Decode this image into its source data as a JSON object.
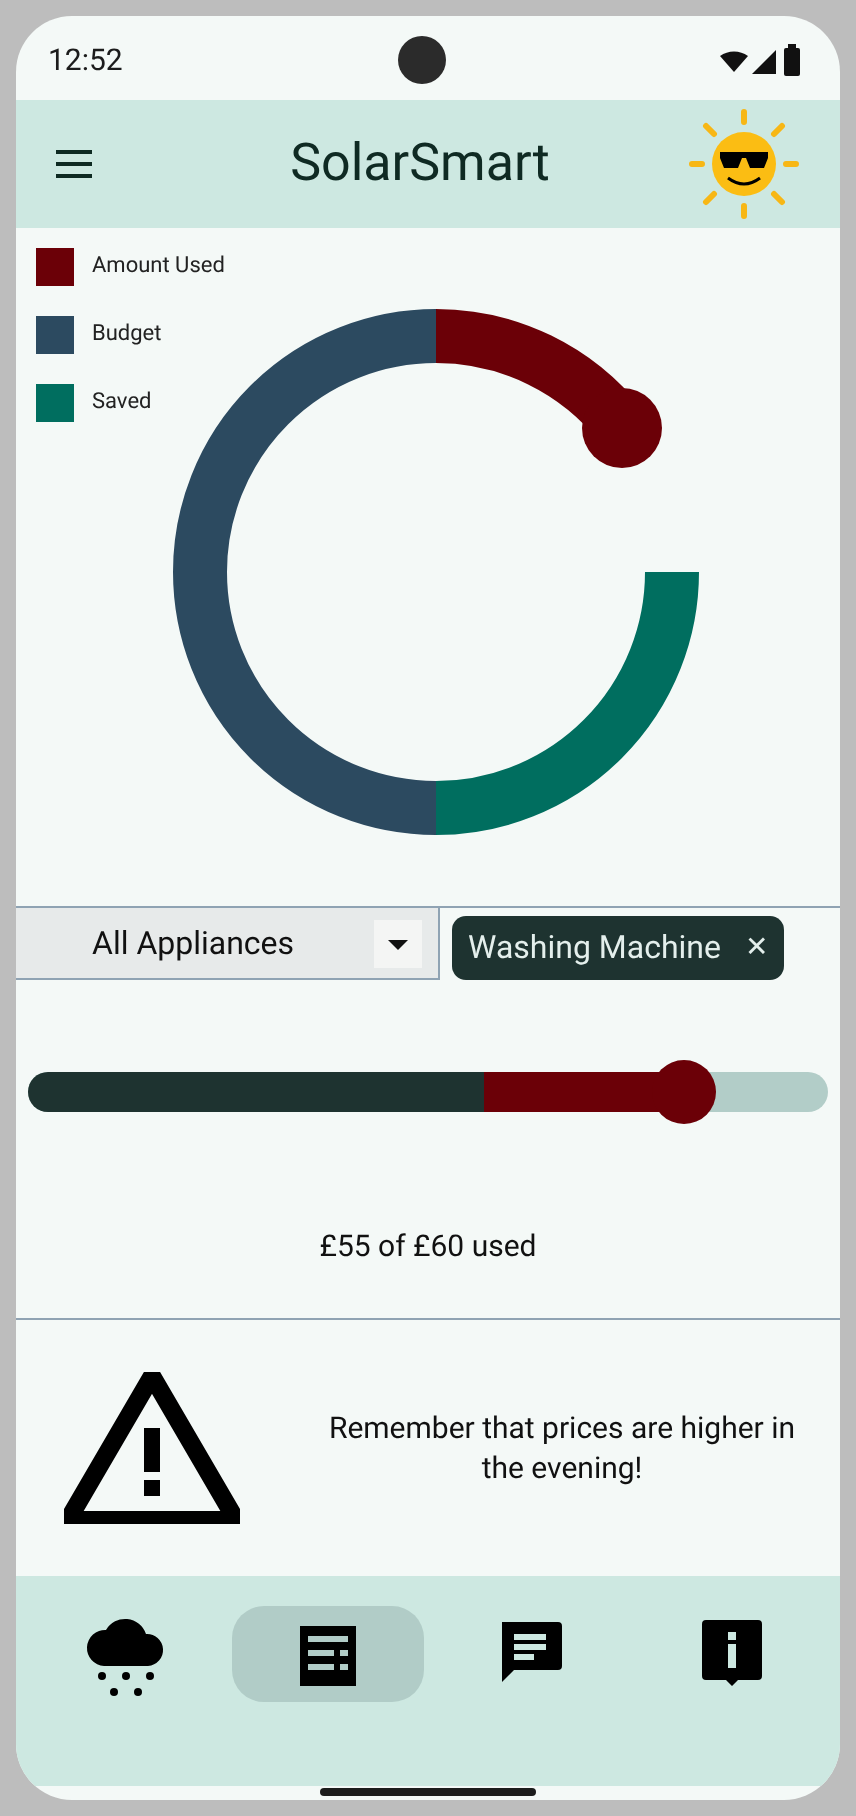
{
  "status_bar": {
    "time": "12:52"
  },
  "app_bar": {
    "title": "SolarSmart"
  },
  "legend": [
    {
      "label": "Amount Used",
      "color": "#6b0007"
    },
    {
      "label": "Budget",
      "color": "#2c4a60"
    },
    {
      "label": "Saved",
      "color": "#006e5f"
    }
  ],
  "filter": {
    "dropdown": "All Appliances",
    "chip": "Washing Machine",
    "chip_close": "✕"
  },
  "slider": {
    "level": 0.82
  },
  "usage_text": "£55 of £60 used",
  "alert": {
    "text": "Remember that prices are higher in the evening!"
  },
  "nav": [
    {
      "kind": "weather",
      "selected": false
    },
    {
      "kind": "bill",
      "selected": true
    },
    {
      "kind": "chat",
      "selected": false
    },
    {
      "kind": "info",
      "selected": false
    }
  ]
}
